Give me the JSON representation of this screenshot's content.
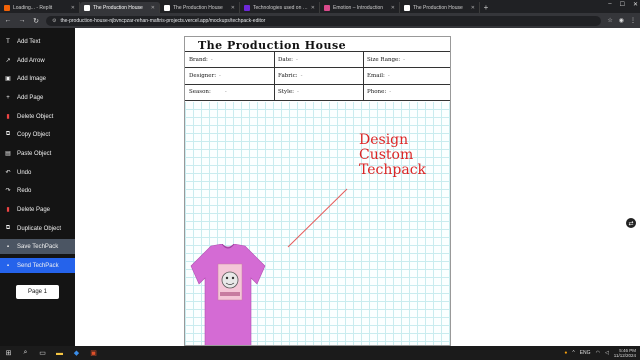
{
  "browser": {
    "tabs": [
      {
        "title": "Loading... - Replit",
        "active": false,
        "color": "#f26207"
      },
      {
        "title": "The Production House",
        "active": true,
        "color": "#ffffff"
      },
      {
        "title": "The Production House",
        "active": false,
        "color": "#ffffff"
      },
      {
        "title": "Technologies used on wordpress",
        "active": false,
        "color": "#6d28d9"
      },
      {
        "title": "Emotion – Introduction",
        "active": false,
        "color": "#d94a8c"
      },
      {
        "title": "The Production House",
        "active": false,
        "color": "#ffffff"
      }
    ],
    "new_tab": "+",
    "url": "the-production-house-njbvncpzar-rehan-maftris-projects.vercel.app/mockups/techpack-editor"
  },
  "sidebar": {
    "items": [
      {
        "label": "Add Text",
        "icon": "T",
        "icon_name": "text-icon"
      },
      {
        "label": "Add Arrow",
        "icon": "↗",
        "icon_name": "arrow-icon"
      },
      {
        "label": "Add Image",
        "icon": "▣",
        "icon_name": "image-icon"
      },
      {
        "label": "Add Page",
        "icon": "+",
        "icon_name": "plus-icon"
      },
      {
        "label": "Delete Object",
        "icon": "🗑",
        "icon_name": "trash-icon"
      },
      {
        "label": "Copy Object",
        "icon": "⧉",
        "icon_name": "copy-icon"
      },
      {
        "label": "Paste Object",
        "icon": "📋",
        "icon_name": "clipboard-icon"
      },
      {
        "label": "Undo",
        "icon": "↶",
        "icon_name": "undo-icon"
      },
      {
        "label": "Redo",
        "icon": "↷",
        "icon_name": "redo-icon"
      },
      {
        "label": "Delete Page",
        "icon": "🗑",
        "icon_name": "trash-icon"
      },
      {
        "label": "Duplicate Object",
        "icon": "⧉",
        "icon_name": "duplicate-icon"
      },
      {
        "label": "Save TechPack",
        "icon": "💾",
        "icon_name": "save-icon"
      },
      {
        "label": "Send TechPack",
        "icon": "✉",
        "icon_name": "send-icon"
      }
    ],
    "page_button": "Page 1"
  },
  "techpack": {
    "title": "The  Production  House",
    "fields": {
      "brand": {
        "label": "Brand:",
        "value": "-"
      },
      "date": {
        "label": "Date:",
        "value": "-"
      },
      "size_range": {
        "label": "Size Range:",
        "value": "-"
      },
      "designer": {
        "label": "Designer:",
        "value": "-"
      },
      "fabric": {
        "label": "Fabric:",
        "value": "-"
      },
      "email": {
        "label": "Email:",
        "value": "-"
      },
      "season": {
        "label": "Season:",
        "value": "-"
      },
      "style": {
        "label": "Style:",
        "value": "-"
      },
      "phone": {
        "label": "Phone:",
        "value": "-"
      }
    },
    "promo_lines": [
      "Design",
      "Custom",
      "Techpack"
    ],
    "promo_color": "#dc2626",
    "shirt_color": "#d46bd4"
  },
  "taskbar": {
    "clock_time": "5:46 PM",
    "clock_date": "11/12/2024",
    "lang": "ENG"
  }
}
